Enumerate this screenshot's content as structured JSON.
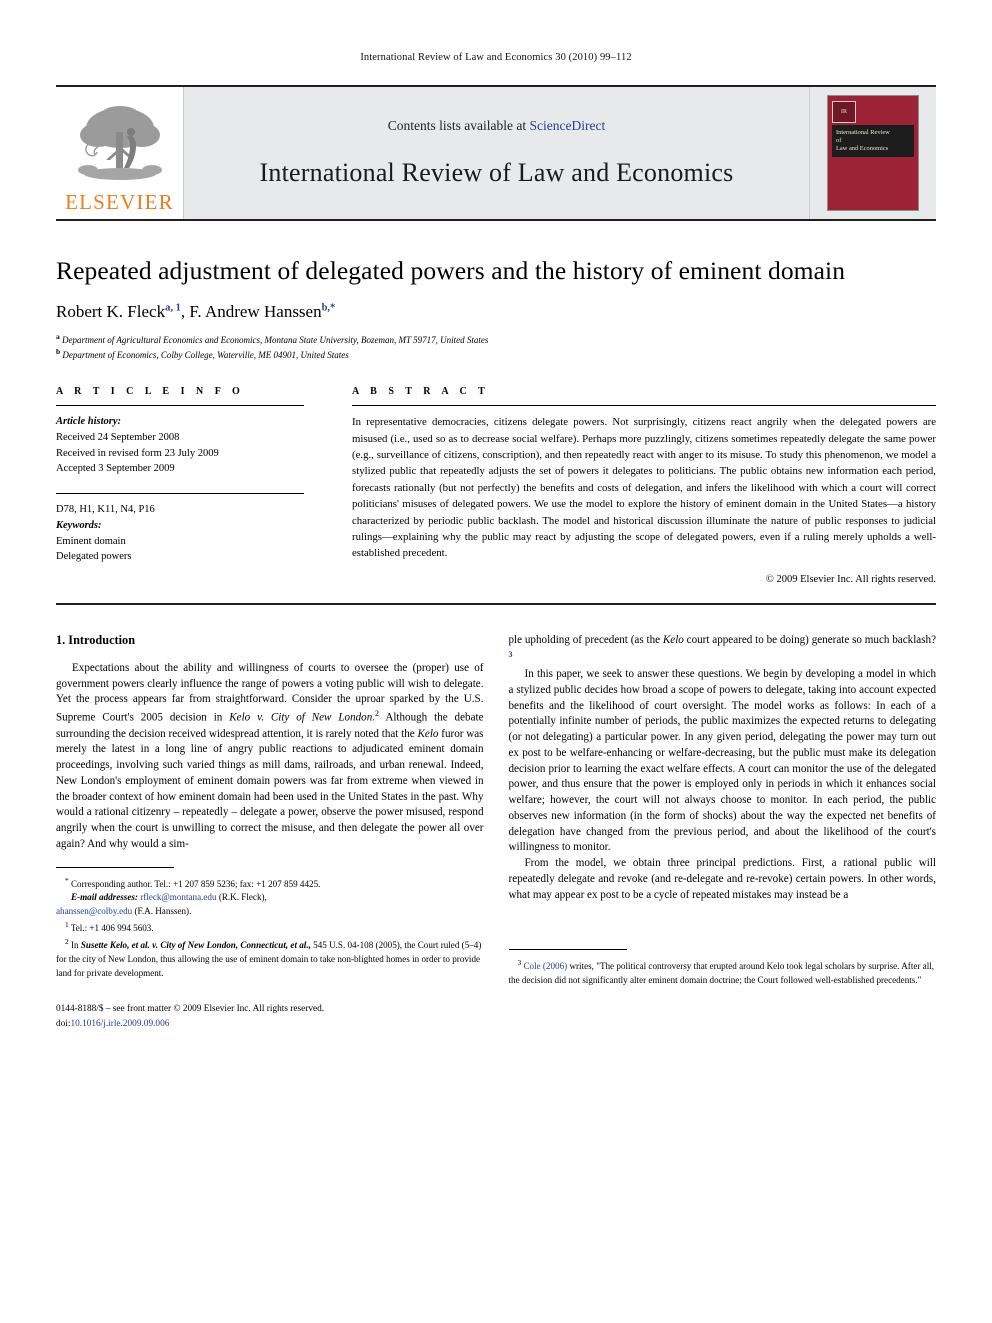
{
  "running_head": "International Review of Law and Economics 30 (2010) 99–112",
  "masthead": {
    "publisher_name": "ELSEVIER",
    "contents_prefix": "Contents lists available at ",
    "sciencedirect": "ScienceDirect",
    "journal_title": "International Review of Law and Economics",
    "cover": {
      "logo_mark": "IR",
      "band_line1": "International Review",
      "band_line2": "of",
      "band_line3": "Law and Economics"
    }
  },
  "article": {
    "title": "Repeated adjustment of delegated powers and the history of eminent domain",
    "authors": [
      {
        "name": "Robert K. Fleck",
        "marks": "a, 1"
      },
      {
        "name": "F. Andrew Hanssen",
        "marks": "b,*"
      }
    ],
    "authors_line": "Robert K. Fleck",
    "affiliations": [
      {
        "mark": "a",
        "text": "Department of Agricultural Economics and Economics, Montana State University, Bozeman, MT 59717, United States"
      },
      {
        "mark": "b",
        "text": "Department of Economics, Colby College, Waterville, ME 04901, United States"
      }
    ]
  },
  "info": {
    "heading": "A R T I C L E  I N F O",
    "history_label": "Article history:",
    "history": [
      "Received 24 September 2008",
      "Received in revised form 23 July 2009",
      "Accepted 3 September 2009"
    ],
    "jel_codes": "D78, H1, K11, N4, P16",
    "keywords_label": "Keywords:",
    "keywords": [
      "Eminent domain",
      "Delegated powers"
    ]
  },
  "abstract": {
    "heading": "A B S T R A C T",
    "text": "In representative democracies, citizens delegate powers. Not surprisingly, citizens react angrily when the delegated powers are misused (i.e., used so as to decrease social welfare). Perhaps more puzzlingly, citizens sometimes repeatedly delegate the same power (e.g., surveillance of citizens, conscription), and then repeatedly react with anger to its misuse. To study this phenomenon, we model a stylized public that repeatedly adjusts the set of powers it delegates to politicians. The public obtains new information each period, forecasts rationally (but not perfectly) the benefits and costs of delegation, and infers the likelihood with which a court will correct politicians' misuses of delegated powers. We use the model to explore the history of eminent domain in the United States—a history characterized by periodic public backlash. The model and historical discussion illuminate the nature of public responses to judicial rulings—explaining why the public may react by adjusting the scope of delegated powers, even if a ruling merely upholds a well-established precedent.",
    "copyright": "© 2009 Elsevier Inc. All rights reserved."
  },
  "body": {
    "section_number_title": "1.  Introduction",
    "left_para_1_a": "Expectations about the ability and willingness of courts to oversee the (proper) use of government powers clearly influence the range of powers a voting public will wish to delegate. Yet the process appears far from straightforward. Consider the uproar sparked by the U.S. Supreme Court's 2005 decision in ",
    "left_para_1_case": "Kelo v. City of New London",
    "left_para_1_fn": "2",
    "left_para_1_b": " Although the debate surrounding the decision received widespread attention, it is rarely noted that the ",
    "left_para_1_case2": "Kelo",
    "left_para_1_c": " furor was merely the latest in a long line of angry public reactions to adjudicated eminent domain proceedings, involving such varied things as mill dams, railroads, and urban renewal. Indeed, New London's employment of eminent domain powers was far from extreme when viewed in the broader context of how eminent domain had been used in the United States in the past. Why would a rational citizenry – repeatedly – delegate a power, observe the power misused, respond angrily when the court is unwilling to correct the misuse, and then delegate the power all over again? And why would a sim-",
    "right_para_0_a": "ple upholding of precedent (as the ",
    "right_para_0_case": "Kelo",
    "right_para_0_b": " court appeared to be doing) generate so much backlash?",
    "right_para_0_fn": "3",
    "right_para_1": "In this paper, we seek to answer these questions. We begin by developing a model in which a stylized public decides how broad a scope of powers to delegate, taking into account expected benefits and the likelihood of court oversight. The model works as follows: In each of a potentially infinite number of periods, the public maximizes the expected returns to delegating (or not delegating) a particular power. In any given period, delegating the power may turn out ex post to be welfare-enhancing or welfare-decreasing, but the public must make its delegation decision prior to learning the exact welfare effects. A court can monitor the use of the delegated power, and thus ensure that the power is employed only in periods in which it enhances social welfare; however, the court will not always choose to monitor. In each period, the public observes new information (in the form of shocks) about the way the expected net benefits of delegation have changed from the previous period, and about the likelihood of the court's willingness to monitor.",
    "right_para_2": "From the model, we obtain three principal predictions. First, a rational public will repeatedly delegate and revoke (and re-delegate and re-revoke) certain powers. In other words, what may appear ex post to be a cycle of repeated mistakes may instead be a"
  },
  "footnotes": {
    "left": {
      "star_mark": "*",
      "star_line1": "Corresponding author. Tel.: +1 207 859 5236; fax: +1 207 859 4425.",
      "email_label": "E-mail addresses:",
      "email1": "rfleck@montana.edu",
      "email1_who": "(R.K. Fleck),",
      "email2": "ahanssen@colby.edu",
      "email2_who": "(F.A. Hanssen).",
      "fn1_mark": "1",
      "fn1_text": "Tel.: +1 406 994 5603.",
      "fn2_mark": "2",
      "fn2_a": "In ",
      "fn2_case": "Susette Kelo, et al. v. City of New London, Connecticut, et al.,",
      "fn2_b": " 545 U.S. 04-108 (2005), the Court ruled (5–4) for the city of New London, thus allowing the use of eminent domain to take non-blighted homes in order to provide land for private development."
    },
    "right": {
      "fn3_mark": "3",
      "fn3_cite": "Cole (2006)",
      "fn3_text": " writes, \"The political controversy that erupted around Kelo took legal scholars by surprise. After all, the decision did not significantly alter eminent domain doctrine; the Court followed well-established precedents.\""
    }
  },
  "imprint": {
    "line1": "0144-8188/$ – see front matter © 2009 Elsevier Inc. All rights reserved.",
    "doi_label": "doi:",
    "doi_value": "10.1016/j.irle.2009.09.006"
  }
}
